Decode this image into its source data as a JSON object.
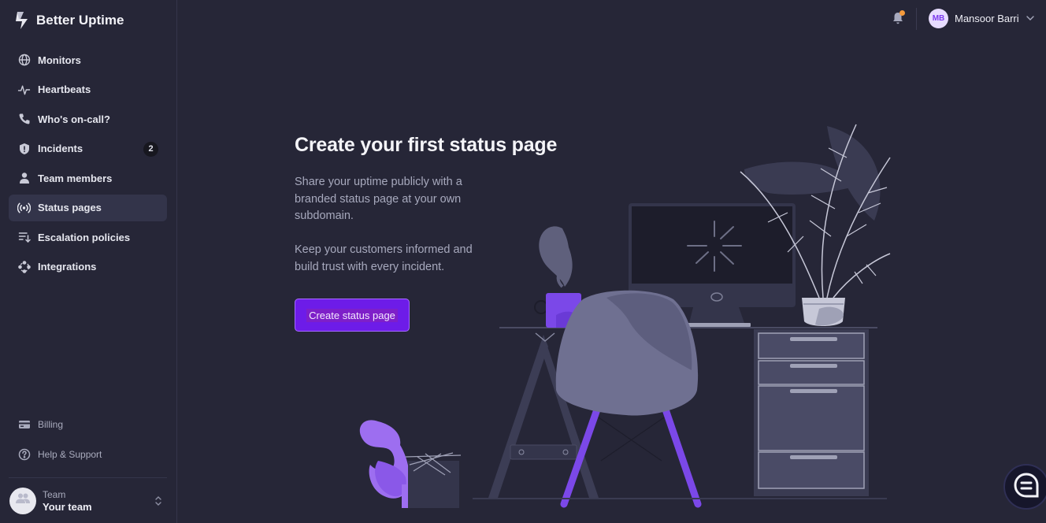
{
  "brand": {
    "name": "Better Uptime",
    "icon": "bolt-icon"
  },
  "sidebar": {
    "items": [
      {
        "label": "Monitors",
        "icon": "globe-icon"
      },
      {
        "label": "Heartbeats",
        "icon": "pulse-icon"
      },
      {
        "label": "Who's on-call?",
        "icon": "phone-icon"
      },
      {
        "label": "Incidents",
        "icon": "shield-icon",
        "badge": "2"
      },
      {
        "label": "Team members",
        "icon": "user-icon"
      },
      {
        "label": "Status pages",
        "icon": "broadcast-icon",
        "active": true
      },
      {
        "label": "Escalation policies",
        "icon": "list-arrow-icon"
      },
      {
        "label": "Integrations",
        "icon": "integrations-icon"
      }
    ],
    "bottom": [
      {
        "label": "Billing",
        "icon": "credit-card-icon"
      },
      {
        "label": "Help & Support",
        "icon": "question-icon"
      }
    ],
    "team": {
      "label": "Team",
      "name": "Your team"
    }
  },
  "header": {
    "user_initials": "MB",
    "user_name": "Mansoor Barri",
    "notification_dot_color": "#f59a3c"
  },
  "main": {
    "title": "Create your first status page",
    "paragraph1": "Share your uptime publicly with a branded status page at your own subdomain.",
    "paragraph2": "Keep your customers informed and build trust with every incident.",
    "cta_label": "Create status page"
  },
  "colors": {
    "background": "#262637",
    "accent": "#6d1ce8",
    "active_nav": "#33344a"
  }
}
